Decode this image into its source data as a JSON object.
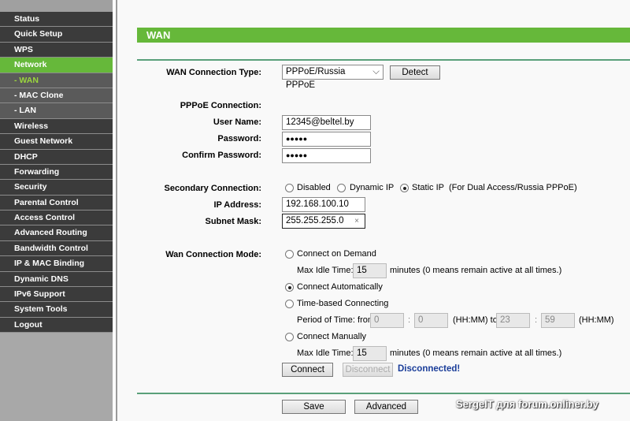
{
  "sidebar": {
    "items": [
      {
        "label": "Status"
      },
      {
        "label": "Quick Setup"
      },
      {
        "label": "WPS"
      },
      {
        "label": "Network"
      },
      {
        "label": "- WAN"
      },
      {
        "label": "- MAC Clone"
      },
      {
        "label": "- LAN"
      },
      {
        "label": "Wireless"
      },
      {
        "label": "Guest Network"
      },
      {
        "label": "DHCP"
      },
      {
        "label": "Forwarding"
      },
      {
        "label": "Security"
      },
      {
        "label": "Parental Control"
      },
      {
        "label": "Access Control"
      },
      {
        "label": "Advanced Routing"
      },
      {
        "label": "Bandwidth Control"
      },
      {
        "label": "IP & MAC Binding"
      },
      {
        "label": "Dynamic DNS"
      },
      {
        "label": "IPv6 Support"
      },
      {
        "label": "System Tools"
      },
      {
        "label": "Logout"
      }
    ]
  },
  "header": {
    "title": "WAN"
  },
  "form": {
    "wan_type_label": "WAN Connection Type:",
    "wan_type_value": "PPPoE/Russia PPPoE",
    "detect": "Detect",
    "pppoe_label": "PPPoE Connection:",
    "username_label": "User Name:",
    "username": "12345@beltel.by",
    "password_label": "Password:",
    "password": "●●●●●",
    "confirm_label": "Confirm Password:",
    "confirm": "●●●●●",
    "secondary_label": "Secondary Connection:",
    "sec_disabled": "Disabled",
    "sec_dynamic": "Dynamic IP",
    "sec_static": "Static IP",
    "sec_note": "(For Dual Access/Russia PPPoE)",
    "ip_label": "IP Address:",
    "ip": "192.168.100.10",
    "mask_label": "Subnet Mask:",
    "mask": "255.255.255.0",
    "clear": "×",
    "mode_label": "Wan Connection Mode:",
    "on_demand": "Connect on Demand",
    "max_idle_label": "Max Idle Time:",
    "idle1": "15",
    "idle_note": "minutes (0 means remain active at all times.)",
    "auto": "Connect Automatically",
    "time_based": "Time-based Connecting",
    "period_label": "Period of Time: from",
    "from_h": "0",
    "colon": ":",
    "from_m": "0",
    "hhmm_to": "(HH:MM) to",
    "to_h": "23",
    "to_m": "59",
    "hhmm": "(HH:MM)",
    "manual": "Connect Manually",
    "idle2": "15",
    "connect": "Connect",
    "disconnect": "Disconnect",
    "status": "Disconnected!",
    "save": "Save",
    "advanced": "Advanced"
  },
  "colors": {
    "accent": "#66b83a",
    "status": "#1a3d99"
  },
  "watermark": "SergeIT для forum.onliner.by"
}
